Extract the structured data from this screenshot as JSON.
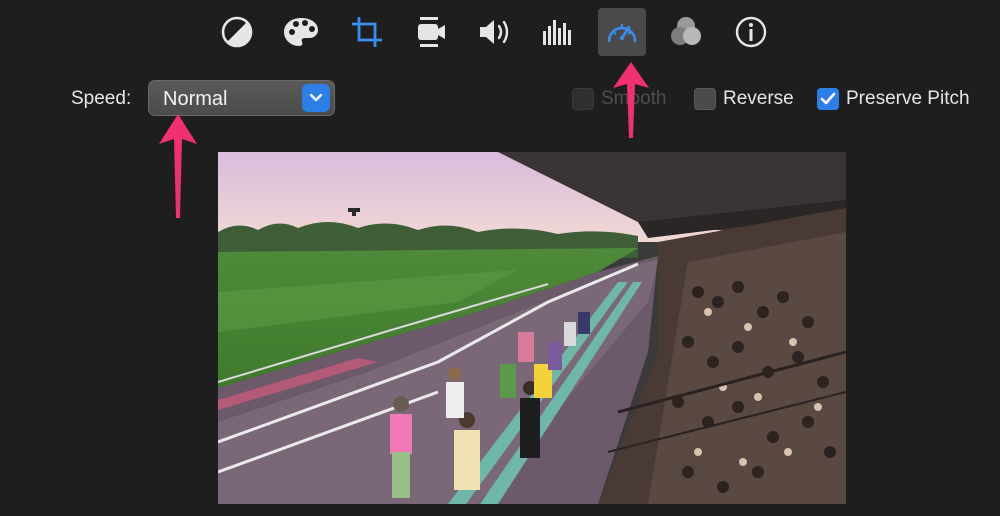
{
  "toolbar": {
    "tools": [
      {
        "icon": "color-balance-icon"
      },
      {
        "icon": "color-palette-icon"
      },
      {
        "icon": "crop-icon"
      },
      {
        "icon": "stabilization-icon"
      },
      {
        "icon": "volume-icon"
      },
      {
        "icon": "equalizer-icon"
      },
      {
        "icon": "speed-icon",
        "active": true
      },
      {
        "icon": "clip-filter-icon"
      },
      {
        "icon": "info-icon"
      }
    ],
    "active_color": "#2d7fe8"
  },
  "speed": {
    "label": "Speed:",
    "selected": "Normal"
  },
  "options": {
    "smooth": {
      "label": "Smooth",
      "checked": false,
      "enabled": false
    },
    "reverse": {
      "label": "Reverse",
      "checked": false,
      "enabled": true
    },
    "preserve_pitch": {
      "label": "Preserve Pitch",
      "checked": true,
      "enabled": true
    }
  },
  "annotation_color": "#f0306f"
}
